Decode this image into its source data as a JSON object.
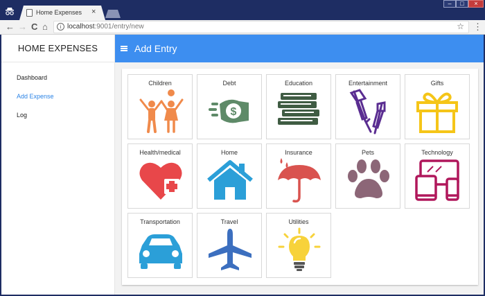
{
  "browser": {
    "tab_title": "Home Expenses",
    "tab_close": "×",
    "url_host": "localhost",
    "url_path": ":9001/entry/new",
    "back_icon": "←",
    "forward_icon": "→",
    "reload_icon": "C",
    "home_icon": "⌂",
    "star_icon": "☆",
    "menu_icon": "⋮",
    "info_icon": "i",
    "window_minimize": "–",
    "window_maximize": "□",
    "window_close": "×"
  },
  "sidebar": {
    "brand": "HOME EXPENSES",
    "items": [
      {
        "label": "Dashboard",
        "active": false
      },
      {
        "label": "Add Expense",
        "active": true
      },
      {
        "label": "Log",
        "active": false
      }
    ]
  },
  "header": {
    "title": "Add Entry"
  },
  "categories": [
    {
      "label": "Children",
      "icon": "children-icon",
      "color": "#f08a4b"
    },
    {
      "label": "Debt",
      "icon": "money-hand-icon",
      "color": "#5e8a68"
    },
    {
      "label": "Education",
      "icon": "books-icon",
      "color": "#3f5c43"
    },
    {
      "label": "Entertainment",
      "icon": "fireworks-icon",
      "color": "#5a2d91"
    },
    {
      "label": "Gifts",
      "icon": "gift-icon",
      "color": "#f5c518"
    },
    {
      "label": "Health/medical",
      "icon": "heart-plus-icon",
      "color": "#e8474a"
    },
    {
      "label": "Home",
      "icon": "house-icon",
      "color": "#2b9fd8"
    },
    {
      "label": "Insurance",
      "icon": "umbrella-icon",
      "color": "#d9534f"
    },
    {
      "label": "Pets",
      "icon": "paw-icon",
      "color": "#8c6677"
    },
    {
      "label": "Technology",
      "icon": "devices-icon",
      "color": "#b0175b"
    },
    {
      "label": "Transportation",
      "icon": "car-icon",
      "color": "#2b9fd8"
    },
    {
      "label": "Travel",
      "icon": "airplane-icon",
      "color": "#3c6fbf"
    },
    {
      "label": "Utilities",
      "icon": "lightbulb-icon",
      "color": "#f7d23a"
    }
  ]
}
